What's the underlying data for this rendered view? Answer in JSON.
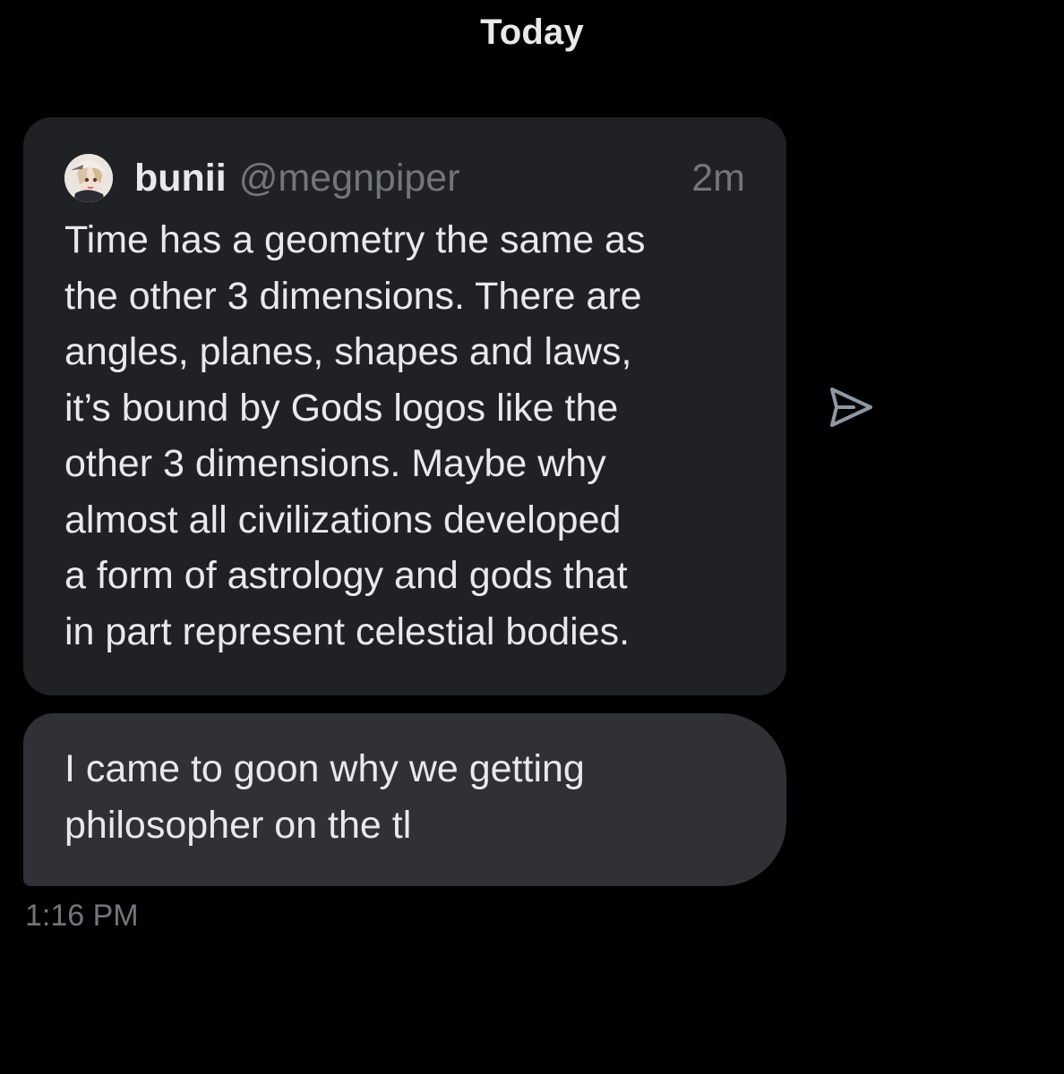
{
  "conversation": {
    "date_divider": "Today"
  },
  "shared_tweet": {
    "author_name": "bunii",
    "author_handle": "@megnpiper",
    "time_ago": "2m",
    "avatar_icon": "avatar-image",
    "text": "Time has a geometry the same as\nthe other 3 dimensions. There are\nangles, planes, shapes and laws,\nit’s bound by Gods logos like the\nother 3 dimensions. Maybe why\nalmost all civilizations  developed\na form of astrology and gods that\nin part represent celestial bodies."
  },
  "share_button": {
    "icon": "send-icon"
  },
  "message": {
    "text": "I came to goon why we getting\nphilosopher on the tl",
    "timestamp": "1:16 PM"
  },
  "colors": {
    "background": "#000000",
    "card": "#202124",
    "bubble": "#2f3136",
    "text": "#e7e9ea",
    "muted": "#71767b"
  }
}
